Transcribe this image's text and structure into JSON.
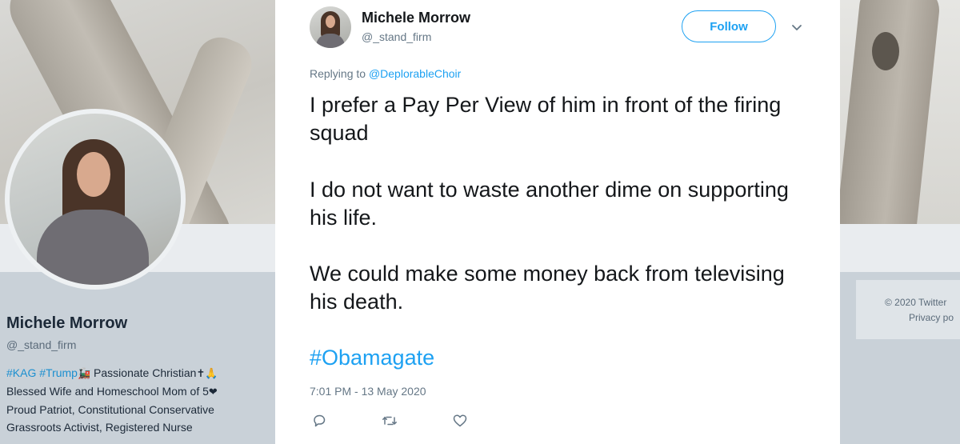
{
  "background_profile": {
    "name": "Michele Morrow",
    "handle": "@_stand_firm",
    "bio": {
      "tag1": "#KAG",
      "tag2": "#Trump",
      "line1_rest": " Passionate Christian",
      "line2": "Blessed Wife and Homeschool Mom of 5",
      "line3": "Proud Patriot, Constitutional Conservative",
      "line4": "Grassroots Activist, Registered Nurse"
    },
    "footer": {
      "copyright": "© 2020 Twitter",
      "privacy": "Privacy po"
    }
  },
  "tweet": {
    "author_name": "Michele Morrow",
    "author_handle": "@_stand_firm",
    "follow_label": "Follow",
    "replying_prefix": "Replying to ",
    "replying_mention": "@DeplorableChoir",
    "paragraph1": "I prefer a Pay Per View of him in front of the firing squad",
    "paragraph2": "I do not want to waste another dime on supporting his life.",
    "paragraph3": "We could make some money back from televising his death.",
    "hashtag": "#Obamagate",
    "timestamp": "7:01 PM - 13 May 2020"
  },
  "icons": {
    "reply": "reply-icon",
    "retweet": "retweet-icon",
    "like": "heart-icon",
    "more": "chevron-down-icon"
  },
  "colors": {
    "accent": "#1da1f2",
    "text": "#14171a",
    "muted": "#657786"
  }
}
